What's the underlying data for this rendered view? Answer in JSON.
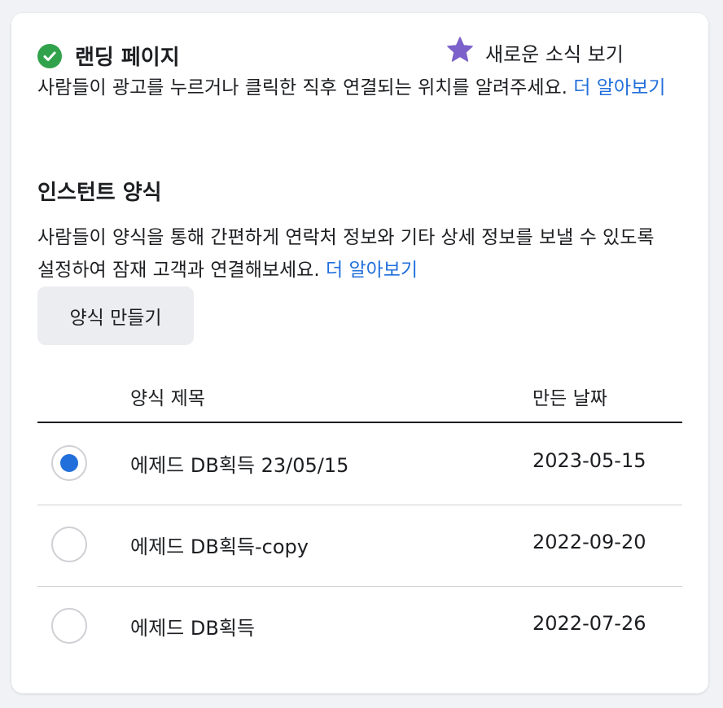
{
  "landing": {
    "title": "랜딩 페이지",
    "description": "사람들이 광고를 누르거나 클릭한 직후 연결되는 위치를 알려주세요.",
    "learn_more": "더 알아보기"
  },
  "news_link": {
    "label": "새로운 소식 보기",
    "icon": "star-icon"
  },
  "instant_form": {
    "title": "인스턴트 양식",
    "description": "사람들이 양식을 통해 간편하게 연락처 정보와 기타 상세 정보를 보낼 수 있도록 설정하여 잠재 고객과 연결해보세요.",
    "learn_more": "더 알아보기",
    "create_button": "양식 만들기"
  },
  "table": {
    "headers": {
      "title": "양식 제목",
      "date": "만든 날짜"
    },
    "rows": [
      {
        "title": "에제드 DB획득 23/05/15",
        "date": "2023-05-15",
        "selected": true
      },
      {
        "title": "에제드 DB획득-copy",
        "date": "2022-09-20",
        "selected": false
      },
      {
        "title": "에제드 DB획득",
        "date": "2022-07-26",
        "selected": false
      }
    ]
  },
  "colors": {
    "accent": "#216fdb",
    "success": "#31a24c",
    "star": "#7b61c9"
  }
}
